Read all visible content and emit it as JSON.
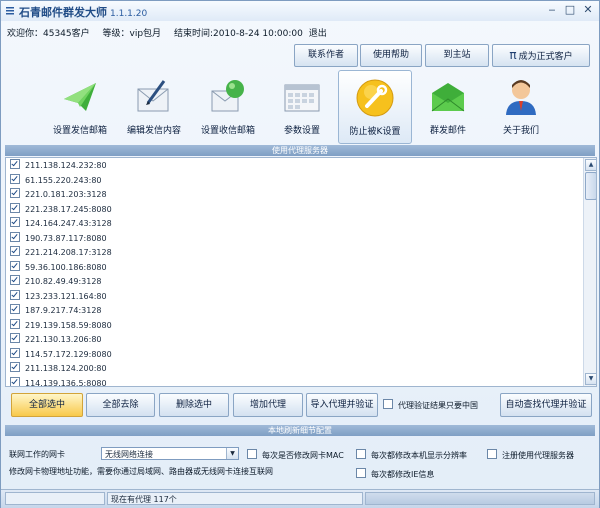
{
  "window": {
    "title": "石青邮件群发大师",
    "version": "1.1.1.20"
  },
  "info": {
    "welcome": "欢迎你：45345客户",
    "level": "等级：vip包月",
    "end_time": "结束时间:2010-8-24 10:00:00",
    "logout": "退出"
  },
  "top_buttons": {
    "contact": "联系作者",
    "help": "使用帮助",
    "home": "到主站",
    "upgrade": "成为正式客户"
  },
  "toolbar": [
    {
      "label": "设置发信邮箱",
      "icon": "send-mailbox-icon"
    },
    {
      "label": "编辑发信内容",
      "icon": "edit-letter-icon"
    },
    {
      "label": "设置收信邮箱",
      "icon": "receive-mailbox-icon"
    },
    {
      "label": "参数设置",
      "icon": "calendar-settings-icon"
    },
    {
      "label": "防止被K设置",
      "icon": "wrench-icon"
    },
    {
      "label": "群发邮件",
      "icon": "green-envelope-icon"
    },
    {
      "label": "关于我们",
      "icon": "user-avatar-icon"
    }
  ],
  "proxy_section_title": "使用代理服务器",
  "proxies": [
    "211.138.124.232:80",
    "61.155.220.243:80",
    "221.0.181.203:3128",
    "221.238.17.245:8080",
    "124.164.247.43:3128",
    "190.73.87.117:8080",
    "221.214.208.17:3128",
    "59.36.100.186:8080",
    "210.82.49.49:3128",
    "123.233.121.164:80",
    "187.9.217.74:3128",
    "219.139.158.59:8080",
    "221.130.13.206:80",
    "114.57.172.129:8080",
    "211.138.124.200:80",
    "114.139.136.5:8080"
  ],
  "proxy_buttons": {
    "select_all": "全部选中",
    "clear_all": "全部去除",
    "delete": "删除选中",
    "add": "增加代理",
    "import": "导入代理并验证",
    "auto": "自动查找代理并验证"
  },
  "proxy_option": "代理验证结果只要中国",
  "local_section_title": "本地刷新细节配置",
  "nic_label": "联网工作的网卡",
  "nic_value": "无线网络连接",
  "options": {
    "change_mac": "每次是否修改网卡MAC",
    "change_resolution": "每次都修改本机显示分辨率",
    "register_proxy": "注册使用代理服务器",
    "change_ie": "每次都修改IE信息"
  },
  "mac_note": "修改网卡物理地址功能，需要你通过局域网、路由器或无线网卡连接互联网",
  "status": {
    "proxy_count": "现在有代理 117个"
  }
}
